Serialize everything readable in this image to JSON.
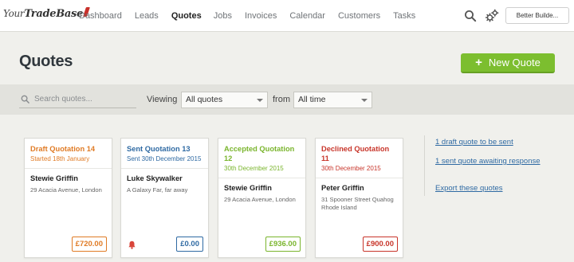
{
  "brand": {
    "logo_your": "Your",
    "logo_tradebase": "TradeBase"
  },
  "nav": [
    {
      "label": "Dashboard",
      "active": false
    },
    {
      "label": "Leads",
      "active": false
    },
    {
      "label": "Quotes",
      "active": true
    },
    {
      "label": "Jobs",
      "active": false
    },
    {
      "label": "Invoices",
      "active": false
    },
    {
      "label": "Calendar",
      "active": false
    },
    {
      "label": "Customers",
      "active": false
    },
    {
      "label": "Tasks",
      "active": false
    }
  ],
  "header": {
    "account_label": "Better Builde..."
  },
  "page": {
    "title": "Quotes",
    "new_button_label": "New Quote"
  },
  "filters": {
    "search_placeholder": "Search quotes...",
    "viewing_label": "Viewing",
    "viewing_value": "All quotes",
    "from_label": "from",
    "from_value": "All time"
  },
  "quotes": [
    {
      "title": "Draft Quotation 14",
      "date": "Started 18th January",
      "customer": "Stewie Griffin",
      "address": "29 Acacia Avenue, London",
      "amount": "£720.00",
      "color": "#e07b25",
      "reminder": false
    },
    {
      "title": "Sent Quotation 13",
      "date": "Sent 30th December 2015",
      "customer": "Luke Skywalker",
      "address": "A Galaxy Far, far away",
      "amount": "£0.00",
      "color": "#2f6aa3",
      "reminder": true
    },
    {
      "title": "Accepted Quotation 12",
      "date": "30th December 2015",
      "customer": "Stewie Griffin",
      "address": "29 Acacia Avenue, London",
      "amount": "£936.00",
      "color": "#7ab52d",
      "reminder": false
    },
    {
      "title": "Declined Quotation 11",
      "date": "30th December 2015",
      "customer": "Peter Griffin",
      "address": "31 Spooner Street Quahog Rhode Island",
      "amount": "£900.00",
      "color": "#c8352a",
      "reminder": false
    }
  ],
  "sidebar": {
    "links": [
      "1 draft quote to be sent",
      "1 sent quote awaiting response",
      "Export these quotes"
    ]
  },
  "icons": {
    "search": "search-icon",
    "settings": "gears-icon",
    "add": "plus-icon",
    "reminder": "bell-icon"
  },
  "colors": {
    "accent_green": "#7cbe2f",
    "link_blue": "#2f6aa3"
  }
}
